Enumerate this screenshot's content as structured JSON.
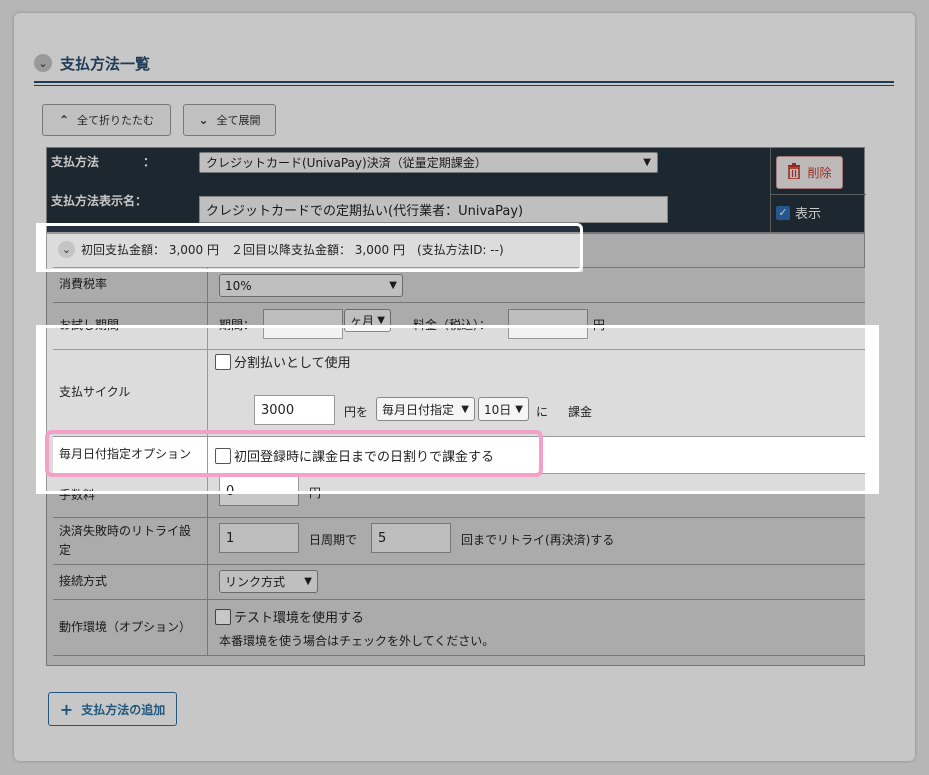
{
  "section": {
    "title": "支払方法一覧"
  },
  "toolbar": {
    "collapse_all": "全て折りたたむ",
    "expand_all": "全て展開"
  },
  "header": {
    "method_label": "支払方法",
    "method_value": "クレジットカード(UnivaPay)決済（従量定期課金）",
    "display_label": "支払方法表示名：",
    "display_value": "クレジットカードでの定期払い(代行業者：UnivaPay)",
    "delete_label": "削除",
    "show_label": "表示"
  },
  "summary": {
    "text": "初回支払金額： 3,000 円　２回目以降支払金額： 3,000 円　(支払方法ID: --)"
  },
  "rows": {
    "tax": {
      "label": "消費税率",
      "value": "10%"
    },
    "trial": {
      "label": "お試し期間",
      "period_label": "期間：",
      "period_value": "",
      "unit": "ヶ月",
      "fee_label": "料金（税込）：",
      "fee_value": "",
      "yen": "円"
    },
    "cycle": {
      "label": "支払サイクル",
      "installment": "分割払いとして使用",
      "amount": "3000",
      "yen_wo": "円を",
      "mode": "毎月日付指定",
      "day": "10日",
      "ni": "に",
      "charge": "課金"
    },
    "monthly_option": {
      "label": "毎月日付指定オプション",
      "checkbox": "初回登録時に課金日までの日割りで課金する"
    },
    "fee": {
      "label": "手数料",
      "value": "0",
      "yen": "円"
    },
    "retry": {
      "label": "決済失敗時のリトライ設定",
      "interval": "1",
      "interval_unit": "日周期で",
      "count": "5",
      "count_unit": "回までリトライ(再決済)する"
    },
    "connection": {
      "label": "接続方式",
      "value": "リンク方式"
    },
    "env": {
      "label": "動作環境（オプション）",
      "checkbox": "テスト環境を使用する",
      "note": "本番環境を使う場合はチェックを外してください。"
    }
  },
  "add_button": {
    "label": "支払方法の追加"
  },
  "colors": {
    "accent": "#2a4c6e",
    "header_bg": "#25323d",
    "danger": "#c0392b",
    "highlight": "#f3a1c8"
  }
}
